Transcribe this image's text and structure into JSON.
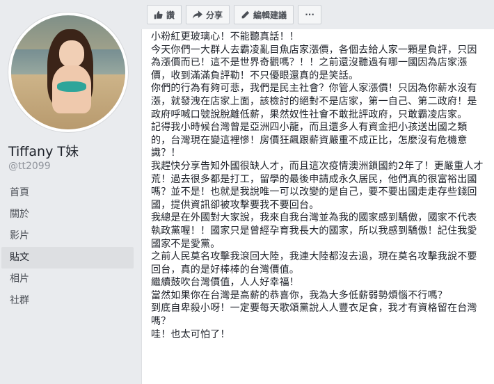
{
  "profile": {
    "name": "Tiffany T妹",
    "handle": "@tt2099"
  },
  "nav": {
    "items": [
      {
        "label": "首頁"
      },
      {
        "label": "關於"
      },
      {
        "label": "影片"
      },
      {
        "label": "貼文"
      },
      {
        "label": "相片"
      },
      {
        "label": "社群"
      }
    ],
    "active": "貼文"
  },
  "toolbar": {
    "like_label": "讚",
    "share_label": "分享",
    "edit_label": "編輯建議",
    "more_label": "···"
  },
  "post": {
    "paragraphs": [
      "小粉紅更玻璃心！不能聽真話！！",
      "今天你們一大群人去霸凌亂目魚店家漲價，各個去給人家一顆星負評，只因為漲價而已！這不是世界奇觀嗎？！！之前還沒聽過有哪一國因為店家漲價，收到滿滿負評勒！不只優眼還真的是笑話。",
      "你們的行為有夠可悲，我們是民主社會？你管人家漲價！只因為你薪水沒有漲，就發洩在店家上面，該檢討的絕對不是店家，第一自己、第二政府！是政府呼喊口號說脫離低薪，果然奴性社會不敢批評政府，只敢霸凌店家。",
      "記得我小時候台灣曾是亞洲四小龍，而且還多人有資金把小孩送出國之類的，台灣現在變這裡慘！房價狂飆跟薪資嚴重不成正比，怎麼沒有危機意識？！",
      "我趕快分享告知外國很缺人才，而且這次疫情澳洲鎖國約2年了！更嚴重人才荒！過去很多都是打工，留學的最後申請成永久居民，他們真的很富裕出國嗎？並不是！也就是我說唯一可以改變的是自己，要不要出國走走存些錢回國，提供資訊卻被攻擊要我不要回台。",
      "我總是在外國對大家說，我來自我台灣並為我的國家感到驕傲，國家不代表執政黨喔！！國家只是曾經孕育我長大的國家，所以我感到驕傲！記住我愛國家不是愛黨。",
      "之前人民莫名攻擊我滾回大陸，我連大陸都沒去過，現在莫名攻擊我說不要回台，真的是好棒棒的台灣價值。",
      "繼續鼓吹台灣價值，人人好幸福！",
      "當然如果你在台灣是高薪的恭喜你，我為大多低薪弱勢煩惱不行嗎？",
      "到底自卑殺小呀！一定要每天歌頌黨說人人豐衣足食，我才有資格留在台灣嗎？",
      "哇！也太可怕了！"
    ]
  },
  "colors": {
    "page_bg": "#e9ebee",
    "nav_active_bg": "#dddfe2",
    "text": "#1d2129",
    "muted": "#90949c"
  },
  "icons": {
    "like": "thumbs-up-icon",
    "share": "share-arrow-icon",
    "edit": "pencil-icon"
  }
}
